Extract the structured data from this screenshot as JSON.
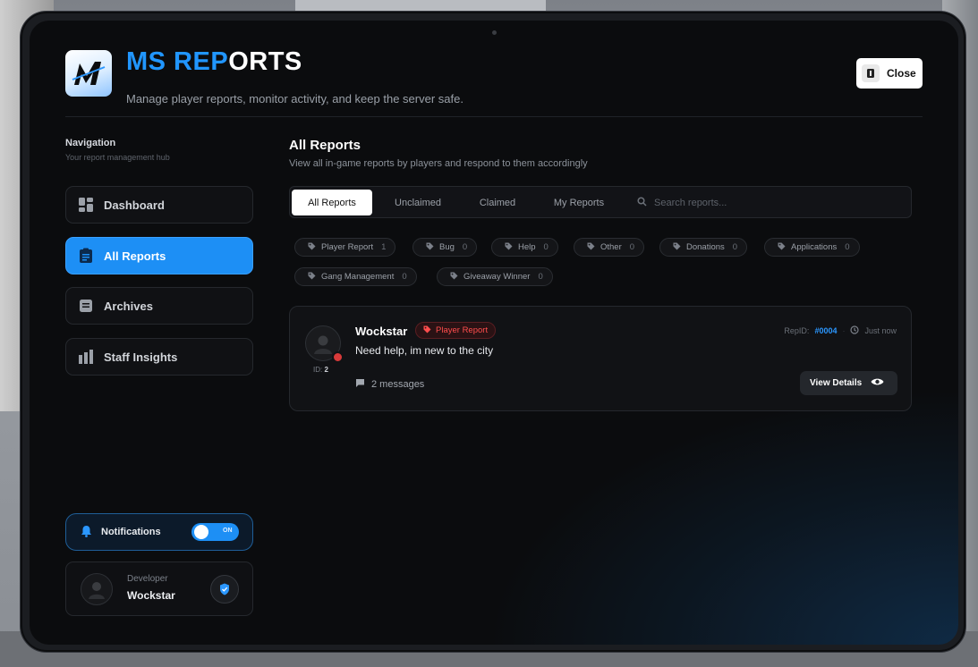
{
  "header": {
    "title_part1": "MS REP",
    "title_part2": "ORTS",
    "subtitle": "Manage player reports, monitor activity, and keep the server safe.",
    "close_label": "Close"
  },
  "sidebar": {
    "title": "Navigation",
    "subtitle": "Your report management hub",
    "items": [
      {
        "label": "Dashboard",
        "icon": "dashboard-icon",
        "active": false
      },
      {
        "label": "All Reports",
        "icon": "clipboard-icon",
        "active": true
      },
      {
        "label": "Archives",
        "icon": "archive-icon",
        "active": false
      },
      {
        "label": "Staff Insights",
        "icon": "bar-chart-icon",
        "active": false
      }
    ],
    "notifications": {
      "label": "Notifications",
      "toggle_label": "ON",
      "enabled": true
    },
    "profile": {
      "role": "Developer",
      "name": "Wockstar"
    }
  },
  "main": {
    "title": "All Reports",
    "subtitle": "View all in-game reports by players and respond to them accordingly",
    "tabs": [
      "All Reports",
      "Unclaimed",
      "Claimed",
      "My Reports"
    ],
    "active_tab": "All Reports",
    "search_placeholder": "Search reports...",
    "categories": [
      {
        "label": "Player Report",
        "count": "1"
      },
      {
        "label": "Bug",
        "count": "0"
      },
      {
        "label": "Help",
        "count": "0"
      },
      {
        "label": "Other",
        "count": "0"
      },
      {
        "label": "Donations",
        "count": "0"
      },
      {
        "label": "Applications",
        "count": "0"
      },
      {
        "label": "Gang Management",
        "count": "0"
      },
      {
        "label": "Giveaway Winner",
        "count": "0"
      }
    ],
    "reports": [
      {
        "player_name": "Wockstar",
        "player_id_label": "ID:",
        "player_id": "2",
        "category": "Player Report",
        "message": "Need help, im new to the city",
        "rep_id_label": "RepID:",
        "rep_id": "#0004",
        "time": "Just now",
        "messages_count": "2 messages",
        "view_label": "View Details"
      }
    ]
  },
  "colors": {
    "accent": "#1d8ff5",
    "danger": "#ff4d4d",
    "background": "#0b0c0e"
  }
}
